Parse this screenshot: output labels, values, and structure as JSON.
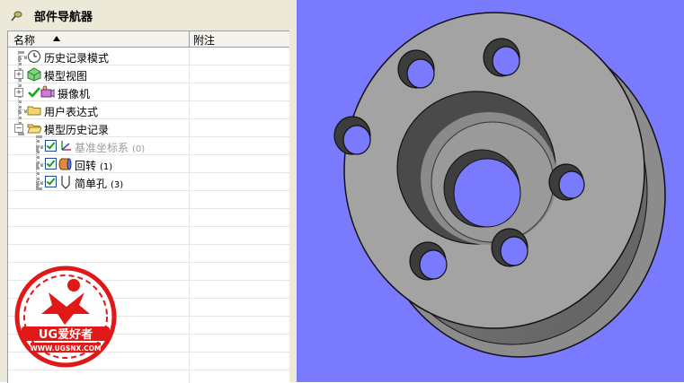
{
  "navigator": {
    "title": "部件导航器",
    "columns": {
      "name": "名称",
      "comment": "附注"
    },
    "items": [
      {
        "label": "历史记录模式"
      },
      {
        "label": "模型视图"
      },
      {
        "label": "摄像机"
      },
      {
        "label": "用户表达式"
      },
      {
        "label": "模型历史记录"
      },
      {
        "label": "基准坐标系",
        "count": "(0)"
      },
      {
        "label": "回转",
        "count": "(1)"
      },
      {
        "label": "简单孔",
        "count": "(3)"
      }
    ]
  },
  "watermark": {
    "brand": "UG爱好者",
    "url": "WWW.UGSNX.COM"
  },
  "colors": {
    "viewport_bg": "#7a7aff",
    "panel_bg": "#ece9d8",
    "part_gray": "#9e9e9e"
  }
}
